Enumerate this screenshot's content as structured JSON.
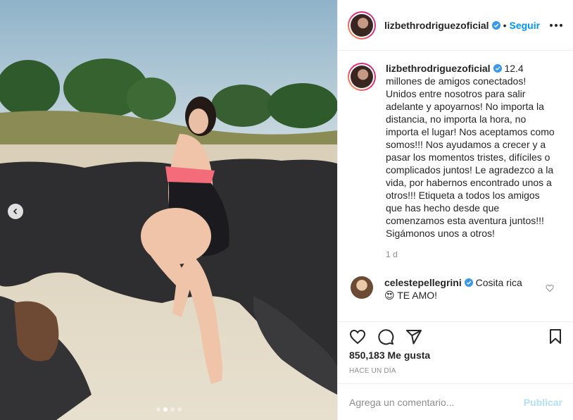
{
  "post": {
    "username": "lizbethrodriguezoficial",
    "follow_label": "Seguir",
    "separator": "•",
    "caption": "12.4 millones de amigos conectados! Unidos entre nosotros para salir adelante y apoyarnos! No importa la distancia, no importa la hora, no importa el lugar! Nos aceptamos como somos!!! Nos ayudamos a crecer y a pasar los momentos tristes, difíciles o complicados juntos! Le agradezco a la vida, por habernos encontrado unos a otros!!! Etiqueta a todos los amigos que has hecho desde que comenzamos esta aventura juntos!!! Sigámonos unos a otros!",
    "caption_time": "1 d",
    "likes": "850,183 Me gusta",
    "posted_ago": "HACE UN DÍA"
  },
  "comments": [
    {
      "username": "celestepellegrini",
      "text": "Cosita rica 😍 TE AMO!"
    }
  ],
  "composer": {
    "placeholder": "Agrega un comentario...",
    "publish_label": "Publicar"
  },
  "carousel": {
    "slide_count": 4,
    "active_index": 1
  },
  "colors": {
    "accent": "#0095f6",
    "publish_disabled": "#b2dffc",
    "verified": "#3897f0"
  },
  "icons": [
    "chevron-left-icon",
    "verified-icon",
    "more-icon",
    "heart-icon",
    "comment-icon",
    "share-icon",
    "save-icon"
  ]
}
